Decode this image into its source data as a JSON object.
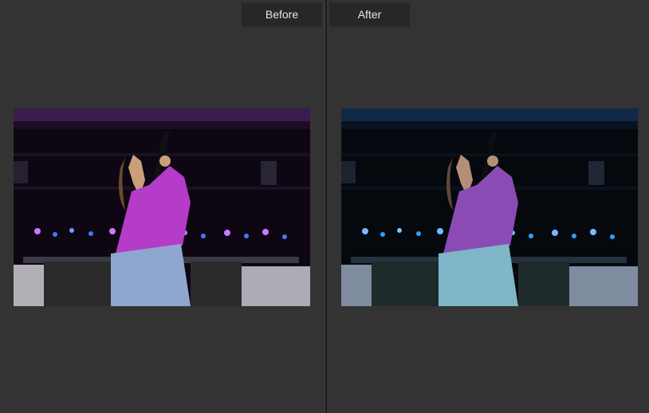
{
  "tabs": {
    "before_label": "Before",
    "after_label": "After"
  },
  "photos": {
    "before": {
      "icon": "photo-before",
      "palette": {
        "ceiling": "#2a1238",
        "bg": "#0e0612",
        "shirt": "#b43cc8",
        "jeans": "#8fa6cf",
        "light": "#7a3cff",
        "banner": "#2a2a2a"
      }
    },
    "after": {
      "icon": "photo-after",
      "palette": {
        "ceiling": "#0b1a33",
        "bg": "#05080d",
        "shirt": "#8a4cb4",
        "jeans": "#7fb6c8",
        "light": "#2f7cff",
        "banner": "#1f2b2a"
      }
    }
  }
}
